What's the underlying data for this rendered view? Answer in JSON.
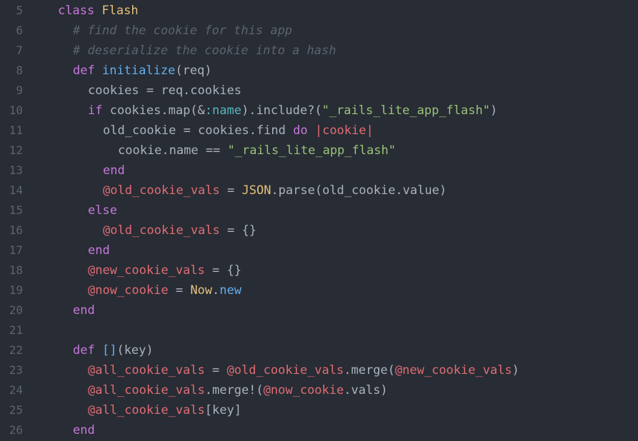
{
  "editor": {
    "lines": [
      {
        "num": "5",
        "indent": 1,
        "tokens": [
          {
            "t": "kw",
            "v": "class"
          },
          {
            "t": "plain",
            "v": " "
          },
          {
            "t": "class",
            "v": "Flash"
          }
        ]
      },
      {
        "num": "6",
        "indent": 2,
        "tokens": [
          {
            "t": "cm",
            "v": "# find the cookie for this app"
          }
        ]
      },
      {
        "num": "7",
        "indent": 2,
        "tokens": [
          {
            "t": "cm",
            "v": "# deserialize the cookie into a hash"
          }
        ]
      },
      {
        "num": "8",
        "indent": 2,
        "tokens": [
          {
            "t": "kw",
            "v": "def"
          },
          {
            "t": "plain",
            "v": " "
          },
          {
            "t": "fn",
            "v": "initialize"
          },
          {
            "t": "plain",
            "v": "(req)"
          }
        ]
      },
      {
        "num": "9",
        "indent": 3,
        "tokens": [
          {
            "t": "plain",
            "v": "cookies = req.cookies"
          }
        ]
      },
      {
        "num": "10",
        "indent": 3,
        "tokens": [
          {
            "t": "kw",
            "v": "if"
          },
          {
            "t": "plain",
            "v": " cookies.map(&"
          },
          {
            "t": "sym",
            "v": ":name"
          },
          {
            "t": "plain",
            "v": ").include?("
          },
          {
            "t": "str",
            "v": "\"_rails_lite_app_flash\""
          },
          {
            "t": "plain",
            "v": ")"
          }
        ]
      },
      {
        "num": "11",
        "indent": 4,
        "tokens": [
          {
            "t": "plain",
            "v": "old_cookie = cookies.find "
          },
          {
            "t": "kw",
            "v": "do"
          },
          {
            "t": "plain",
            "v": " "
          },
          {
            "t": "ivar",
            "v": "|cookie|"
          }
        ]
      },
      {
        "num": "12",
        "indent": 5,
        "tokens": [
          {
            "t": "plain",
            "v": "cookie.name == "
          },
          {
            "t": "str",
            "v": "\"_rails_lite_app_flash\""
          }
        ]
      },
      {
        "num": "13",
        "indent": 4,
        "tokens": [
          {
            "t": "kw",
            "v": "end"
          }
        ]
      },
      {
        "num": "14",
        "indent": 4,
        "tokens": [
          {
            "t": "ivar",
            "v": "@old_cookie_vals"
          },
          {
            "t": "plain",
            "v": " = "
          },
          {
            "t": "class",
            "v": "JSON"
          },
          {
            "t": "plain",
            "v": ".parse(old_cookie.value)"
          }
        ]
      },
      {
        "num": "15",
        "indent": 3,
        "tokens": [
          {
            "t": "kw",
            "v": "else"
          }
        ]
      },
      {
        "num": "16",
        "indent": 4,
        "tokens": [
          {
            "t": "ivar",
            "v": "@old_cookie_vals"
          },
          {
            "t": "plain",
            "v": " = {}"
          }
        ]
      },
      {
        "num": "17",
        "indent": 3,
        "tokens": [
          {
            "t": "kw",
            "v": "end"
          }
        ]
      },
      {
        "num": "18",
        "indent": 3,
        "tokens": [
          {
            "t": "ivar",
            "v": "@new_cookie_vals"
          },
          {
            "t": "plain",
            "v": " = {}"
          }
        ]
      },
      {
        "num": "19",
        "indent": 3,
        "tokens": [
          {
            "t": "ivar",
            "v": "@now_cookie"
          },
          {
            "t": "plain",
            "v": " = "
          },
          {
            "t": "class",
            "v": "Now"
          },
          {
            "t": "plain",
            "v": "."
          },
          {
            "t": "fn",
            "v": "new"
          }
        ]
      },
      {
        "num": "20",
        "indent": 2,
        "tokens": [
          {
            "t": "kw",
            "v": "end"
          }
        ]
      },
      {
        "num": "21",
        "indent": 0,
        "tokens": []
      },
      {
        "num": "22",
        "indent": 2,
        "tokens": [
          {
            "t": "kw",
            "v": "def"
          },
          {
            "t": "plain",
            "v": " "
          },
          {
            "t": "fn",
            "v": "[]"
          },
          {
            "t": "plain",
            "v": "(key)"
          }
        ]
      },
      {
        "num": "23",
        "indent": 3,
        "tokens": [
          {
            "t": "ivar",
            "v": "@all_cookie_vals"
          },
          {
            "t": "plain",
            "v": " = "
          },
          {
            "t": "ivar",
            "v": "@old_cookie_vals"
          },
          {
            "t": "plain",
            "v": ".merge("
          },
          {
            "t": "ivar",
            "v": "@new_cookie_vals"
          },
          {
            "t": "plain",
            "v": ")"
          }
        ]
      },
      {
        "num": "24",
        "indent": 3,
        "tokens": [
          {
            "t": "ivar",
            "v": "@all_cookie_vals"
          },
          {
            "t": "plain",
            "v": ".merge!("
          },
          {
            "t": "ivar",
            "v": "@now_cookie"
          },
          {
            "t": "plain",
            "v": ".vals)"
          }
        ]
      },
      {
        "num": "25",
        "indent": 3,
        "tokens": [
          {
            "t": "ivar",
            "v": "@all_cookie_vals"
          },
          {
            "t": "plain",
            "v": "[key]"
          }
        ]
      },
      {
        "num": "26",
        "indent": 2,
        "tokens": [
          {
            "t": "kw",
            "v": "end"
          }
        ]
      }
    ]
  }
}
